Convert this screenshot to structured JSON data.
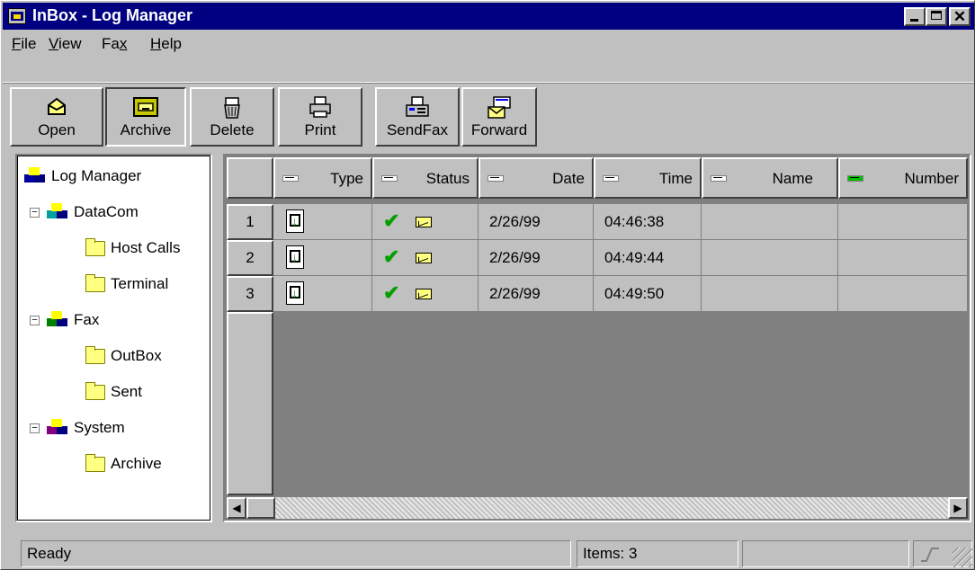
{
  "window": {
    "title": "InBox - Log Manager"
  },
  "menu": [
    {
      "pre": "",
      "accel": "F",
      "post": "ile"
    },
    {
      "pre": "",
      "accel": "V",
      "post": "iew"
    },
    {
      "pre": "Fa",
      "accel": "x",
      "post": ""
    },
    {
      "pre": "",
      "accel": "H",
      "post": "elp"
    }
  ],
  "toolbar": {
    "open": "Open",
    "archive": "Archive",
    "delete": "Delete",
    "print": "Print",
    "sendfax": "SendFax",
    "forward": "Forward"
  },
  "tree": {
    "root": "Log Manager",
    "datacom": "DataCom",
    "host_calls": "Host Calls",
    "terminal": "Terminal",
    "fax": "Fax",
    "outbox": "OutBox",
    "sent": "Sent",
    "system": "System",
    "archive": "Archive",
    "expander": "−"
  },
  "grid": {
    "columns": [
      "Type",
      "Status",
      "Date",
      "Time",
      "Name",
      "Number"
    ],
    "rows": [
      {
        "num": "1",
        "date": "2/26/99",
        "time": "04:46:38",
        "name": "",
        "number": ""
      },
      {
        "num": "2",
        "date": "2/26/99",
        "time": "04:49:44",
        "name": "",
        "number": ""
      },
      {
        "num": "3",
        "date": "2/26/99",
        "time": "04:49:50",
        "name": "",
        "number": ""
      }
    ]
  },
  "status": {
    "ready": "Ready",
    "items": "Items: 3"
  },
  "colors": {
    "title_bar": "#000080",
    "face": "#c0c0c0",
    "check": "#00a000"
  }
}
